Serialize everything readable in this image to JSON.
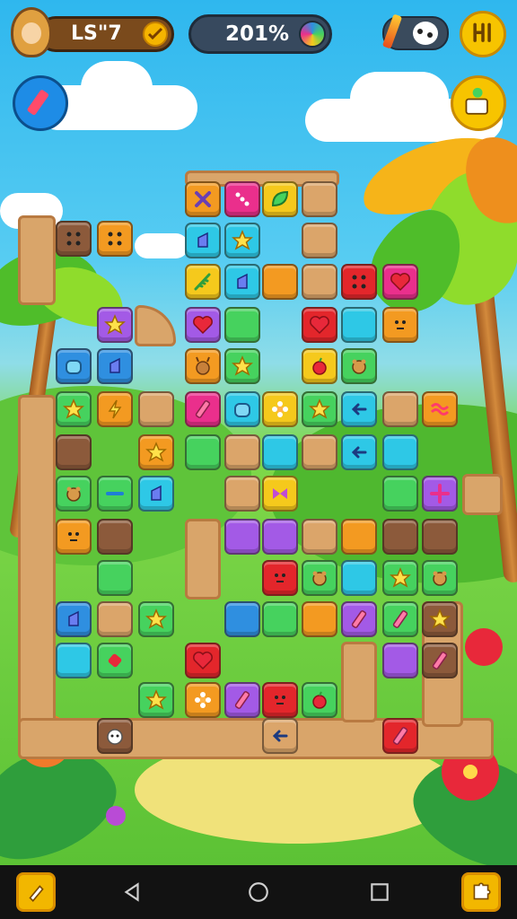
{
  "hud": {
    "level_text": "LS\"7",
    "progress_text": "201%"
  },
  "colors": {
    "tile_cyan": "#2ec8e6",
    "tile_blue": "#2f8fe0",
    "tile_green": "#46d25e",
    "tile_orange": "#f39a21",
    "tile_yellow": "#f5c91c",
    "tile_red": "#e3262b",
    "tile_magenta": "#ea2f8c",
    "tile_purple": "#a35ae6",
    "tile_brown": "#8c5a3b",
    "tile_sand": "#dba56a",
    "hud_gold": "#f7c400",
    "navbar": "#121212"
  },
  "tiles": [
    {
      "color": "#f39a21",
      "icon": "cross-icon"
    },
    {
      "color": "#ea2f8c",
      "icon": "dots-icon"
    },
    {
      "color": "#f5c91c",
      "icon": "leaf-icon"
    },
    {
      "color": "#dba56a",
      "icon": "none"
    },
    {
      "color": "#8c5a3b",
      "icon": "dice-icon"
    },
    {
      "color": "#f39a21",
      "icon": "dice-icon"
    },
    {
      "color": "#2ec8e6",
      "icon": "shard-icon"
    },
    {
      "color": "#2ec8e6",
      "icon": "star-icon"
    },
    {
      "color": "#dba56a",
      "icon": "none"
    },
    {
      "color": "#f5c91c",
      "icon": "feather-icon"
    },
    {
      "color": "#2ec8e6",
      "icon": "shard-icon"
    },
    {
      "color": "#f39a21",
      "icon": "none"
    },
    {
      "color": "#dba56a",
      "icon": "none"
    },
    {
      "color": "#e3262b",
      "icon": "dice-icon"
    },
    {
      "color": "#ea2f8c",
      "icon": "heart-icon"
    },
    {
      "color": "#a35ae6",
      "icon": "star-icon"
    },
    {
      "color": "#a35ae6",
      "icon": "heart-icon"
    },
    {
      "color": "#46d25e",
      "icon": "none"
    },
    {
      "color": "#e3262b",
      "icon": "heart-icon"
    },
    {
      "color": "#2ec8e6",
      "icon": "none"
    },
    {
      "color": "#f39a21",
      "icon": "face-icon"
    },
    {
      "color": "#2f8fe0",
      "icon": "bread-icon"
    },
    {
      "color": "#2f8fe0",
      "icon": "shard-icon"
    },
    {
      "color": "#f39a21",
      "icon": "deer-icon"
    },
    {
      "color": "#46d25e",
      "icon": "star-icon"
    },
    {
      "color": "#f5c91c",
      "icon": "apple-icon"
    },
    {
      "color": "#46d25e",
      "icon": "bear-icon"
    },
    {
      "color": "#46d25e",
      "icon": "star-icon"
    },
    {
      "color": "#f39a21",
      "icon": "bolt-icon"
    },
    {
      "color": "#dba56a",
      "icon": "none"
    },
    {
      "color": "#ea2f8c",
      "icon": "crayon-icon"
    },
    {
      "color": "#2ec8e6",
      "icon": "bread-icon"
    },
    {
      "color": "#f5c91c",
      "icon": "flower-icon"
    },
    {
      "color": "#46d25e",
      "icon": "star-icon"
    },
    {
      "color": "#2ec8e6",
      "icon": "arrow-icon"
    },
    {
      "color": "#dba56a",
      "icon": "none"
    },
    {
      "color": "#f39a21",
      "icon": "wave-icon"
    },
    {
      "color": "#8c5a3b",
      "icon": "none"
    },
    {
      "color": "#f39a21",
      "icon": "star-icon"
    },
    {
      "color": "#46d25e",
      "icon": "none"
    },
    {
      "color": "#dba56a",
      "icon": "none"
    },
    {
      "color": "#2ec8e6",
      "icon": "none"
    },
    {
      "color": "#dba56a",
      "icon": "none"
    },
    {
      "color": "#2ec8e6",
      "icon": "arrow-icon"
    },
    {
      "color": "#2ec8e6",
      "icon": "none"
    },
    {
      "color": "#46d25e",
      "icon": "bear-icon"
    },
    {
      "color": "#46d25e",
      "icon": "dash-icon"
    },
    {
      "color": "#2ec8e6",
      "icon": "shard-icon"
    },
    {
      "color": "#dba56a",
      "icon": "none"
    },
    {
      "color": "#f5c91c",
      "icon": "bow-icon"
    },
    {
      "color": "#46d25e",
      "icon": "none"
    },
    {
      "color": "#46d25e",
      "icon": "none"
    },
    {
      "color": "#a35ae6",
      "icon": "plus-icon"
    },
    {
      "color": "#f39a21",
      "icon": "face-icon"
    },
    {
      "color": "#8c5a3b",
      "icon": "none"
    },
    {
      "color": "#a35ae6",
      "icon": "none"
    },
    {
      "color": "#a35ae6",
      "icon": "none"
    },
    {
      "color": "#dba56a",
      "icon": "none"
    },
    {
      "color": "#f39a21",
      "icon": "none"
    },
    {
      "color": "#8c5a3b",
      "icon": "none"
    },
    {
      "color": "#8c5a3b",
      "icon": "none"
    },
    {
      "color": "#46d25e",
      "icon": "none"
    },
    {
      "color": "#e3262b",
      "icon": "face-icon"
    },
    {
      "color": "#46d25e",
      "icon": "bear-icon"
    },
    {
      "color": "#2ec8e6",
      "icon": "none"
    },
    {
      "color": "#46d25e",
      "icon": "star-icon"
    },
    {
      "color": "#46d25e",
      "icon": "bear-icon"
    },
    {
      "color": "#2f8fe0",
      "icon": "shard-icon"
    },
    {
      "color": "#dba56a",
      "icon": "none"
    },
    {
      "color": "#46d25e",
      "icon": "star-icon"
    },
    {
      "color": "#2f8fe0",
      "icon": "none"
    },
    {
      "color": "#46d25e",
      "icon": "none"
    },
    {
      "color": "#f39a21",
      "icon": "none"
    },
    {
      "color": "#a35ae6",
      "icon": "crayon-icon"
    },
    {
      "color": "#46d25e",
      "icon": "crayon-icon"
    },
    {
      "color": "#8c5a3b",
      "icon": "star-icon"
    },
    {
      "color": "#2ec8e6",
      "icon": "none"
    },
    {
      "color": "#46d25e",
      "icon": "candy-icon"
    },
    {
      "color": "#e3262b",
      "icon": "heart-icon"
    },
    {
      "color": "#a35ae6",
      "icon": "none"
    },
    {
      "color": "#8c5a3b",
      "icon": "crayon-icon"
    },
    {
      "color": "#46d25e",
      "icon": "star-icon"
    },
    {
      "color": "#f39a21",
      "icon": "flower-icon"
    },
    {
      "color": "#a35ae6",
      "icon": "crayon-icon"
    },
    {
      "color": "#e3262b",
      "icon": "face-icon"
    },
    {
      "color": "#46d25e",
      "icon": "apple-icon"
    },
    {
      "color": "#8c5a3b",
      "icon": "sheep-icon"
    },
    {
      "color": "#e3262b",
      "icon": "crayon-icon"
    },
    {
      "color": "#dba56a",
      "icon": "arrow-icon"
    }
  ]
}
